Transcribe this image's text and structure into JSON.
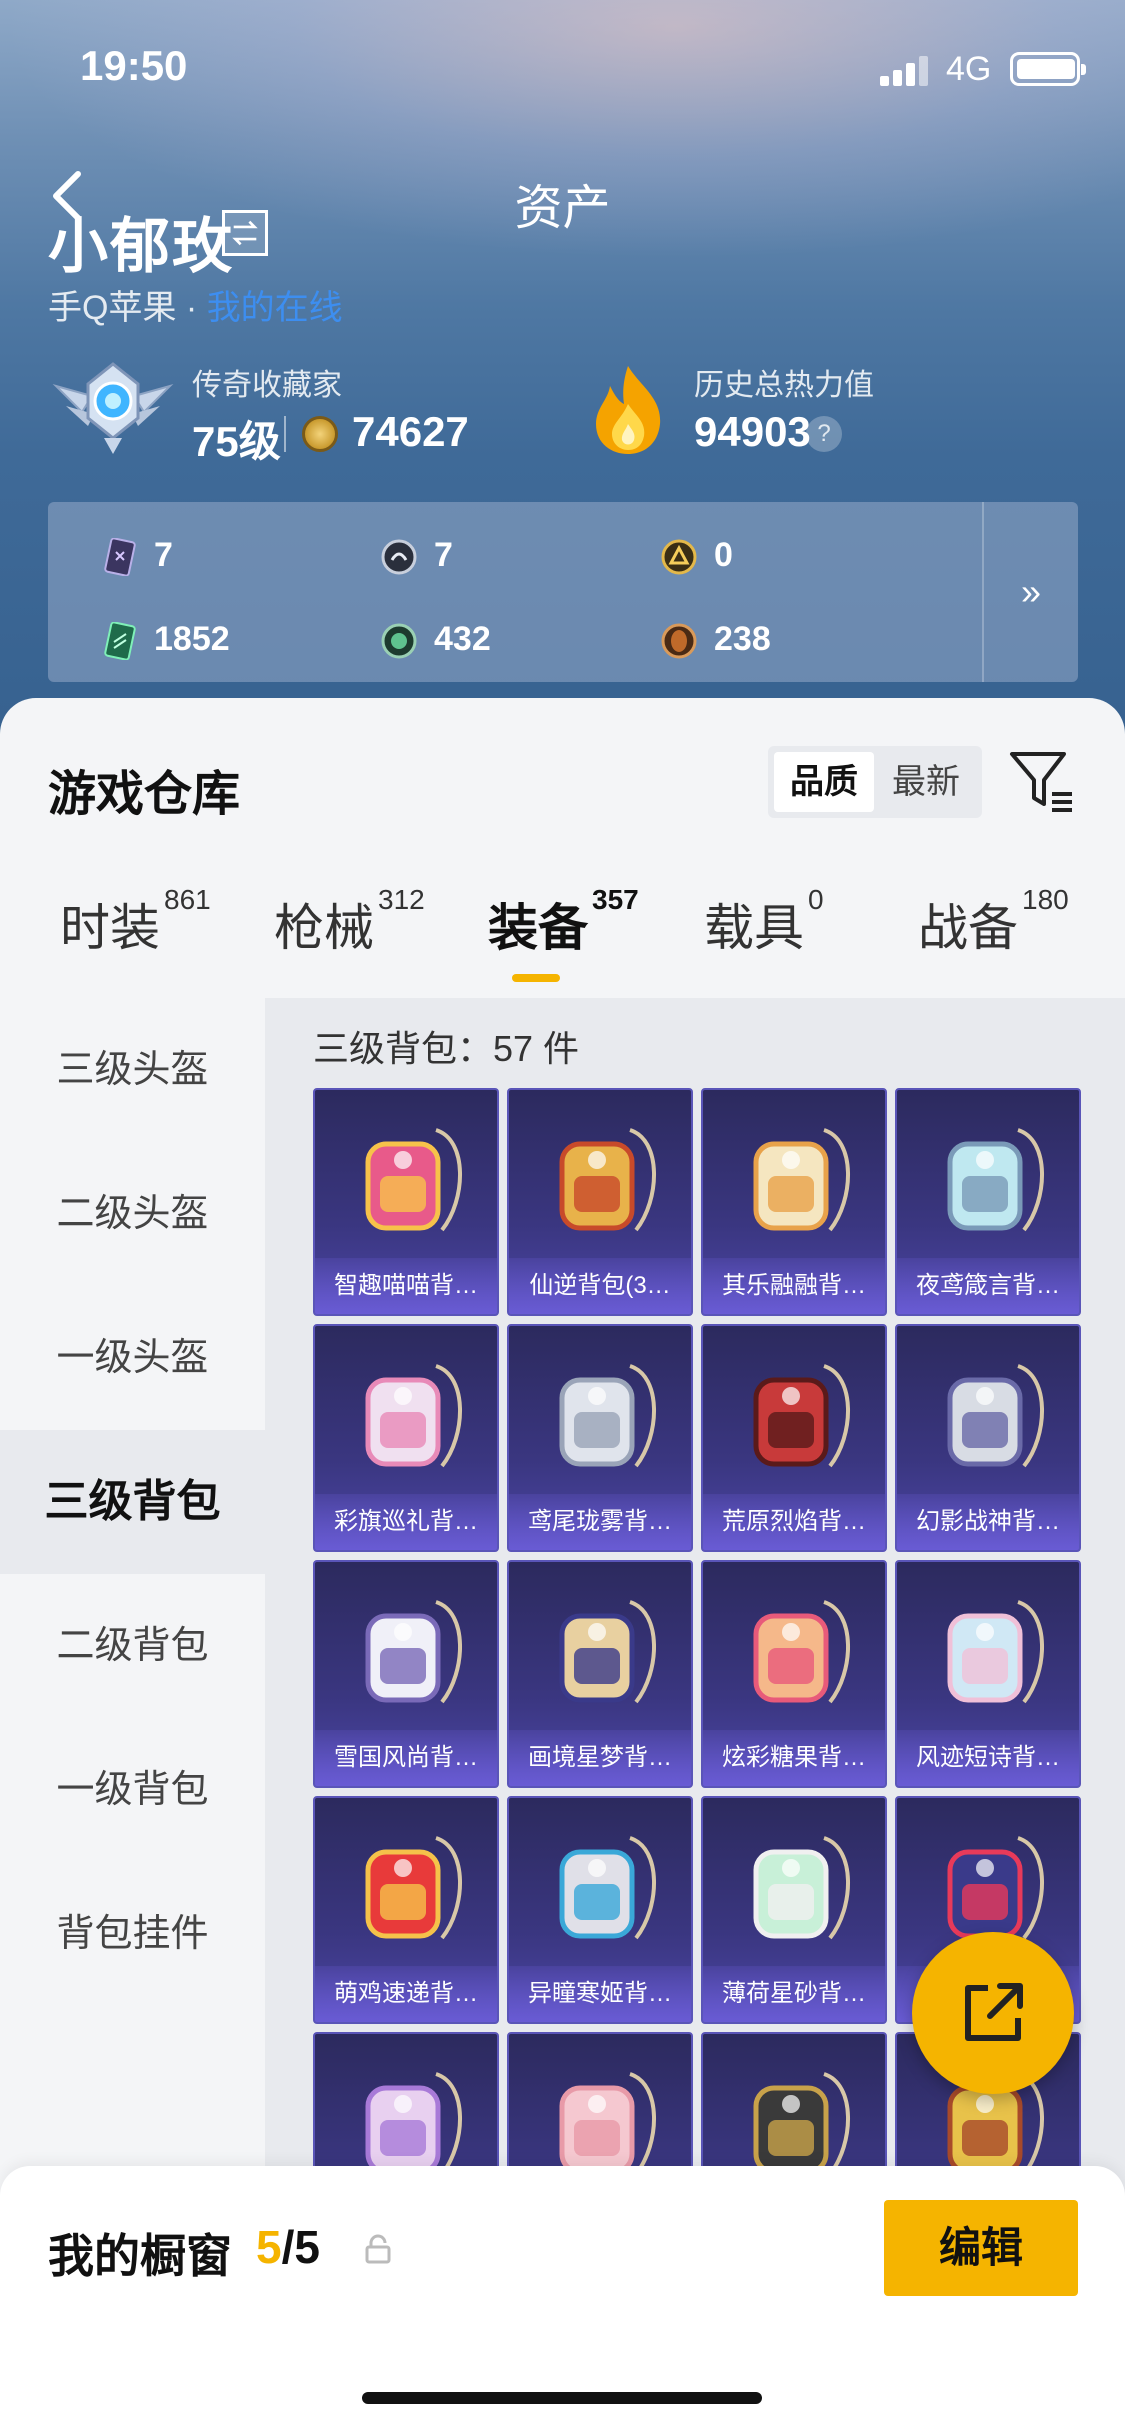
{
  "status_bar": {
    "time": "19:50",
    "network": "4G"
  },
  "header": {
    "title": "资产",
    "player_name": "小郁玫",
    "platform": "手Q苹果",
    "separator": "·",
    "online_status": "我的在线"
  },
  "rank": {
    "label": "传奇收藏家",
    "level": "75级",
    "coins": "74627",
    "heat_label": "历史总热力值",
    "heat_value": "94903",
    "help": "?"
  },
  "currencies": [
    {
      "icon": "card-icon",
      "value": "7"
    },
    {
      "icon": "medal-silver-icon",
      "value": "7"
    },
    {
      "icon": "medal-gold-icon",
      "value": "0"
    },
    {
      "icon": "ticket-green-icon",
      "value": "1852"
    },
    {
      "icon": "gem-green-icon",
      "value": "432"
    },
    {
      "icon": "gem-bronze-icon",
      "value": "238"
    }
  ],
  "more_label": "»",
  "warehouse": {
    "title": "游戏仓库",
    "sort_options": [
      "品质",
      "最新"
    ],
    "active_sort": "品质"
  },
  "tabs": [
    {
      "label": "时装",
      "count": "861"
    },
    {
      "label": "枪械",
      "count": "312"
    },
    {
      "label": "装备",
      "count": "357"
    },
    {
      "label": "载具",
      "count": "0"
    },
    {
      "label": "战备",
      "count": "180"
    }
  ],
  "active_tab": "装备",
  "side_nav": [
    "三级头盔",
    "二级头盔",
    "一级头盔",
    "三级背包",
    "二级背包",
    "一级背包",
    "背包挂件"
  ],
  "active_side": "三级背包",
  "category_count": "三级背包：57 件",
  "items": [
    {
      "name": "智趣喵喵背…",
      "icon": "cat-backpack-icon"
    },
    {
      "name": "仙逆背包(3…",
      "icon": "ornament-backpack-icon"
    },
    {
      "name": "其乐融融背…",
      "icon": "dessert-backpack-icon"
    },
    {
      "name": "夜鸢箴言背…",
      "icon": "jellyfish-backpack-icon"
    },
    {
      "name": "彩旗巡礼背…",
      "icon": "clock-backpack-icon"
    },
    {
      "name": "鸢尾珑雾背…",
      "icon": "silver-backpack-icon"
    },
    {
      "name": "荒原烈焰背…",
      "icon": "flame-backpack-icon"
    },
    {
      "name": "幻影战神背…",
      "icon": "armor-backpack-icon"
    },
    {
      "name": "雪国风尚背…",
      "icon": "penguin-backpack-icon"
    },
    {
      "name": "画境星梦背…",
      "icon": "frame-backpack-icon"
    },
    {
      "name": "炫彩糖果背…",
      "icon": "donut-backpack-icon"
    },
    {
      "name": "风迹短诗背…",
      "icon": "bow-backpack-icon"
    },
    {
      "name": "萌鸡速递背…",
      "icon": "chick-backpack-icon"
    },
    {
      "name": "异瞳寒姬背…",
      "icon": "robot-backpack-icon"
    },
    {
      "name": "薄荷星砂背…",
      "icon": "mint-backpack-icon"
    },
    {
      "name": "",
      "icon": "helmet-backpack-icon"
    },
    {
      "name": "",
      "icon": "crystal-backpack-icon"
    },
    {
      "name": "",
      "icon": "quilted-backpack-icon"
    },
    {
      "name": "",
      "icon": "dragon-backpack-icon"
    },
    {
      "name": "",
      "icon": "gold-backpack-icon"
    }
  ],
  "showcase": {
    "label": "我的橱窗",
    "current": "5",
    "total": "/5",
    "edit_label": "编辑"
  },
  "colors": {
    "accent": "#f5b400",
    "card": "#3a3680",
    "online": "#3d8ef0"
  }
}
